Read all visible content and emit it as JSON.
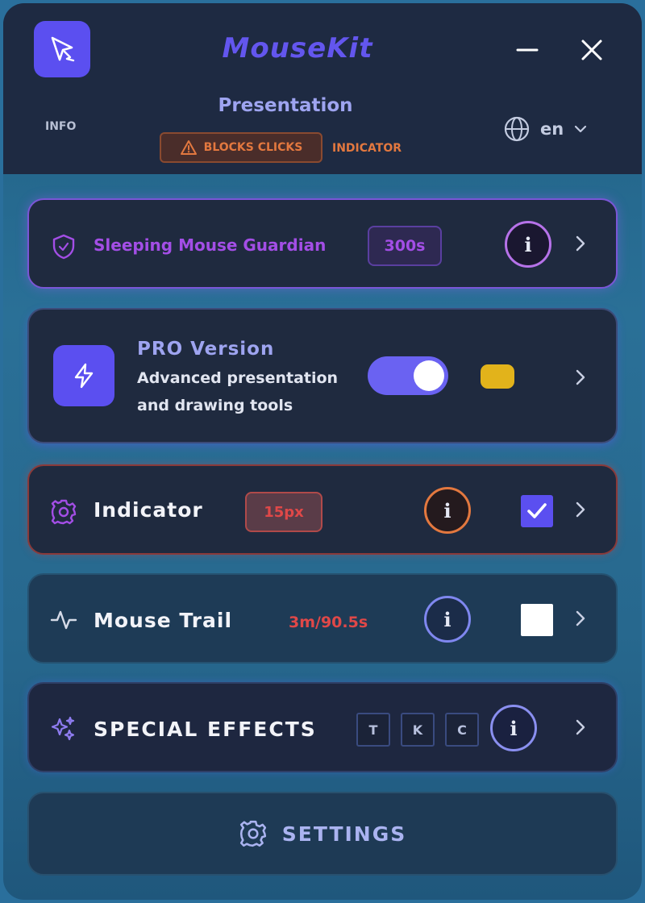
{
  "app": {
    "title": "MouseKit"
  },
  "header": {
    "info_label": "INFO",
    "mode_title": "Presentation",
    "blocks_badge": "BLOCKS CLICKS",
    "indicator_label": "INDICATOR",
    "language": "en"
  },
  "guardian": {
    "label": "Sleeping Mouse Guardian",
    "value": "300s"
  },
  "pro": {
    "title": "PRO Version",
    "desc_line1": "Advanced presentation",
    "desc_line2": "and drawing tools",
    "enabled": true
  },
  "indicator": {
    "label": "Indicator",
    "value": "15px",
    "checked": true
  },
  "trail": {
    "label": "Mouse Trail",
    "value": "3m/90.5s",
    "checked": false
  },
  "effects": {
    "label": "SPECIAL EFFECTS",
    "keys": [
      "T",
      "K",
      "C"
    ]
  },
  "settings": {
    "label": "SETTINGS"
  },
  "icons": {
    "app": "cursor-icon",
    "minimize": "minimize-icon",
    "close": "close-icon",
    "globe": "globe-icon",
    "warning": "warning-icon",
    "shield": "shield-icon",
    "lightning": "lightning-icon",
    "gear": "gear-icon",
    "activity": "activity-icon",
    "sparkles": "sparkles-icon",
    "info": "info-icon",
    "chevron": "chevron-right-icon"
  },
  "colors": {
    "accent": "#5b4ff0",
    "purple": "#a34ee6",
    "orange": "#e3783f",
    "red": "#e04848",
    "yellow": "#e2b31b"
  }
}
